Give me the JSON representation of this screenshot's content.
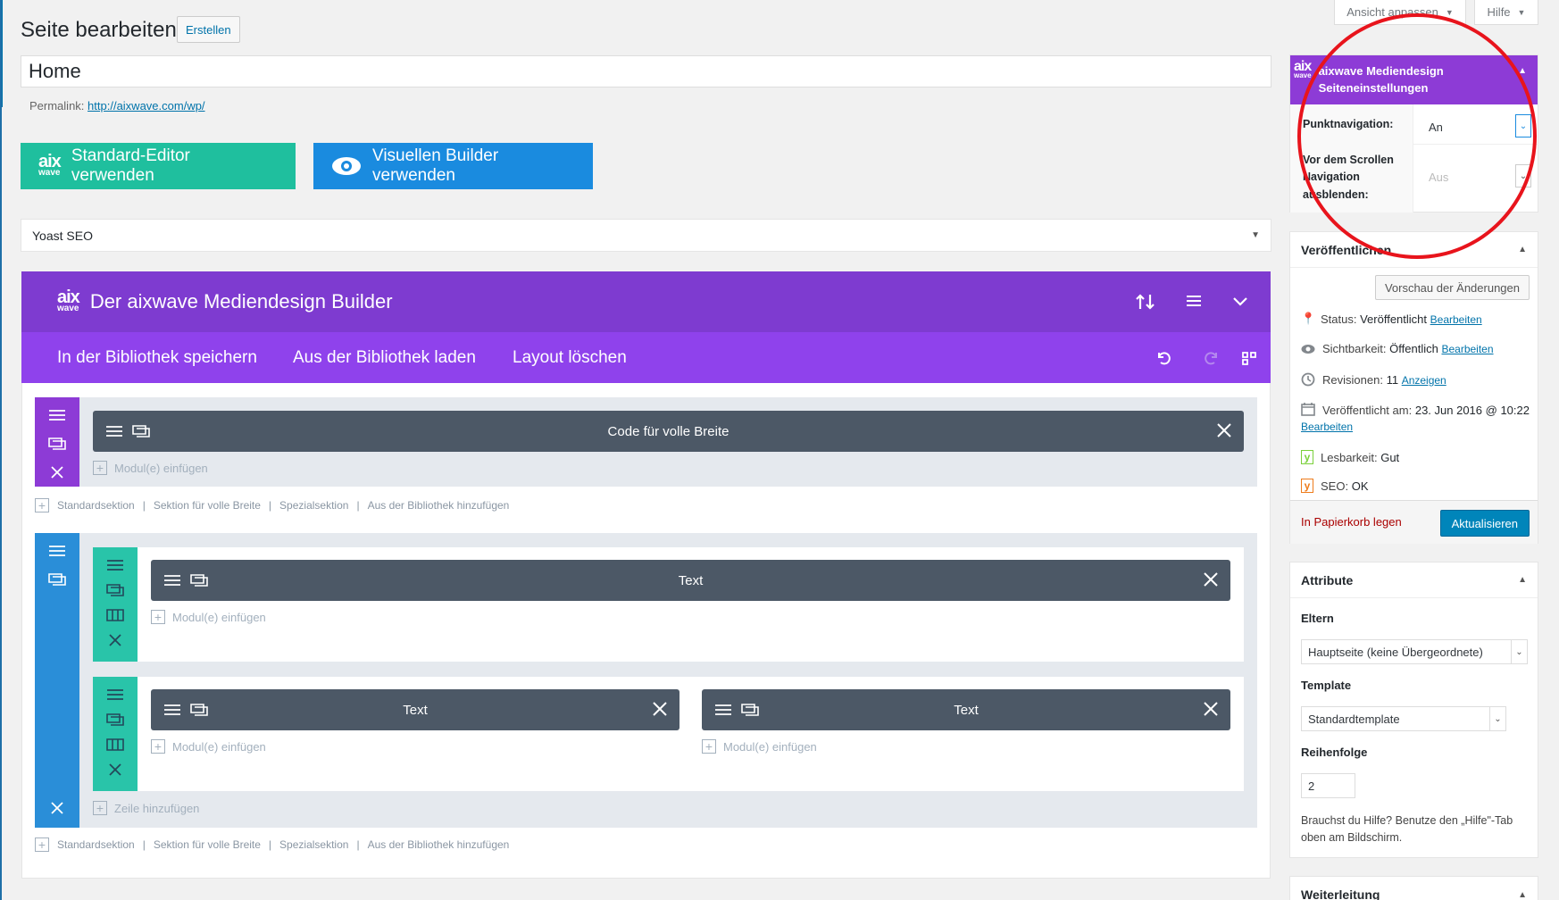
{
  "screen_options": {
    "view": "Ansicht anpassen",
    "help": "Hilfe"
  },
  "page": {
    "title": "Seite bearbeiten",
    "add_new": "Erstellen",
    "post_title": "Home",
    "permalink_label": "Permalink:",
    "permalink_url": "http://aixwave.com/wp/"
  },
  "editor_buttons": {
    "standard": "Standard-Editor verwenden",
    "visual": "Visuellen Builder verwenden",
    "logo_top": "aix",
    "logo_bottom": "wave"
  },
  "yoast": {
    "title": "Yoast SEO"
  },
  "builder": {
    "title": "Der aixwave Mediendesign Builder",
    "save_library": "In der Bibliothek speichern",
    "load_library": "Aus der Bibliothek laden",
    "clear_layout": "Layout löschen",
    "module_fullwidth": "Code für volle Breite",
    "module_text_1": "Text",
    "module_text_2": "Text",
    "module_text_3": "Text",
    "insert_module": "Modul(e) einfügen",
    "add_row": "Zeile hinzufügen",
    "add_links": [
      "Standardsektion",
      "Sektion für volle Breite",
      "Spezialsektion",
      "Aus der Bibliothek hinzufügen"
    ],
    "separator": "|",
    "colors": {
      "header": "#7e3bd0",
      "subbar": "#8f42ec",
      "fullwidth_section": "#8d3bd6",
      "regular_section": "#2a8ed8",
      "row": "#29c4a9",
      "module": "#4c5866"
    }
  },
  "settings_box": {
    "title_line1": "aixwave Mediendesign",
    "title_line2": "Seiteneinstellungen",
    "dot_nav_label": "Punktnavigation:",
    "dot_nav_value": "An",
    "hide_nav_label": "Vor dem Scrollen Navigation ausblenden:",
    "hide_nav_value": "Aus"
  },
  "publish": {
    "title": "Veröffentlichen",
    "preview": "Vorschau der Änderungen",
    "status_label": "Status:",
    "status_value": "Veröffentlicht",
    "visibility_label": "Sichtbarkeit:",
    "visibility_value": "Öffentlich",
    "revisions_label": "Revisionen:",
    "revisions_value": "11",
    "revisions_link": "Anzeigen",
    "published_label": "Veröffentlicht am:",
    "published_value": "23. Jun 2016 @ 10:22",
    "edit": "Bearbeiten",
    "readability_label": "Lesbarkeit:",
    "readability_value": "Gut",
    "seo_label": "SEO:",
    "seo_value": "OK",
    "trash": "In Papierkorb legen",
    "update": "Aktualisieren"
  },
  "attributes": {
    "title": "Attribute",
    "parent_label": "Eltern",
    "parent_value": "Hauptseite (keine Übergeordnete)",
    "template_label": "Template",
    "template_value": "Standardtemplate",
    "order_label": "Reihenfolge",
    "order_value": "2",
    "help_text": "Brauchst du Hilfe? Benutze den „Hilfe\"-Tab oben am Bildschirm."
  },
  "redirect": {
    "title": "Weiterleitung"
  }
}
